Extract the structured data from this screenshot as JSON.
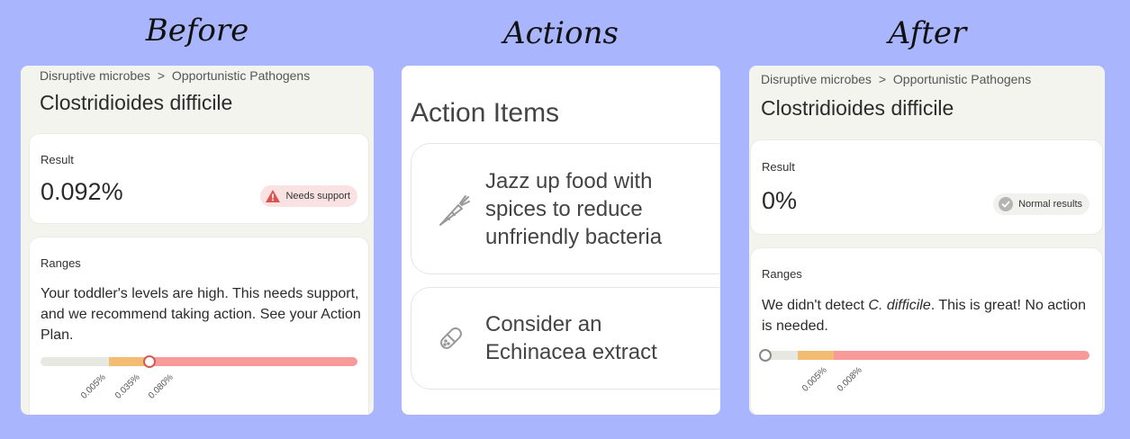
{
  "headings": {
    "before": "Before",
    "actions": "Actions",
    "after": "After"
  },
  "before": {
    "breadcrumb": [
      "Disruptive microbes",
      ">",
      "Opportunistic Pathogens"
    ],
    "title": "Clostridioides difficile",
    "result_label": "Result",
    "result_value": "0.092%",
    "badge": "Needs support",
    "ranges_label": "Ranges",
    "ranges_text": "Your toddler's levels are high. This needs support, and we recommend taking action. See your Action Plan.",
    "ticks": [
      "0.005%",
      "0.035%",
      "0.080%"
    ],
    "marker_fraction": 0.34
  },
  "actions": {
    "title": "Action Items",
    "items": [
      {
        "icon": "carrot-icon",
        "text": "Jazz up food with spices to reduce unfriendly bacteria"
      },
      {
        "icon": "capsule-icon",
        "text": "Consider an Echinacea extract"
      }
    ]
  },
  "after": {
    "breadcrumb": [
      "Disruptive microbes",
      ">",
      "Opportunistic Pathogens"
    ],
    "title": "Clostridioides difficile",
    "result_label": "Result",
    "result_value": "0%",
    "badge": "Normal results",
    "ranges_text_1": "We didn't detect ",
    "ranges_text_em": "C. difficile",
    "ranges_text_2": ". This is great! No action is needed.",
    "ranges_label": "Ranges",
    "ticks": [
      "0.005%",
      "0.008%"
    ],
    "marker_fraction": 0.0
  },
  "colors": {
    "background": "#a9b6fd",
    "normal": "#e8e8e2",
    "borderline": "#f3bc73",
    "high": "#f79a99",
    "alert": "#d9534f"
  }
}
